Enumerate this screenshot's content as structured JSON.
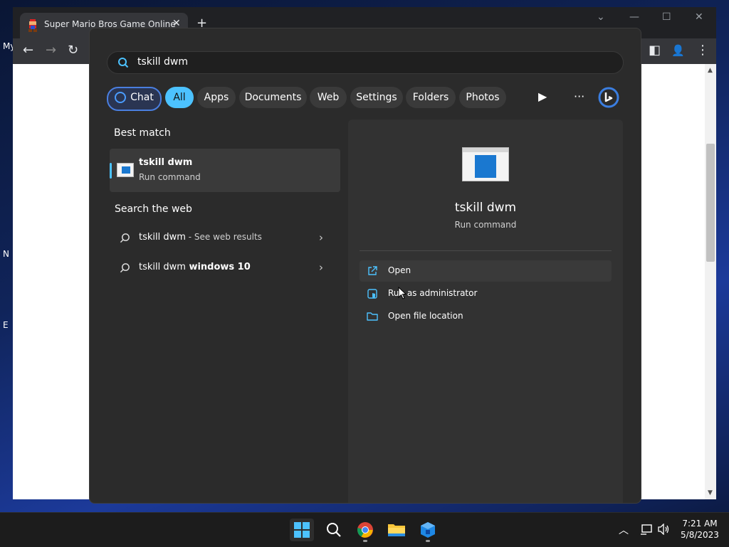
{
  "browser": {
    "tab_title": "Super Mario Bros Game Online",
    "tab_close": "✕",
    "new_tab": "+",
    "window_controls": {
      "dropdown": "⌄",
      "minimize": "—",
      "maximize": "☐",
      "close": "✕"
    },
    "toolbar": {
      "back": "←",
      "forward": "→",
      "reload": "↻",
      "side_panel": "◧",
      "profile": "👤",
      "menu": "⋮"
    }
  },
  "desktop_edge_labels": [
    "My",
    "N",
    "E"
  ],
  "start_menu": {
    "search": {
      "value": "tskill dwm"
    },
    "filters": [
      "Chat",
      "All",
      "Apps",
      "Documents",
      "Web",
      "Settings",
      "Folders",
      "Photos"
    ],
    "active_filter": "All",
    "more_label": "···",
    "best_match": {
      "section_title": "Best match",
      "name": "tskill dwm",
      "subtitle": "Run command"
    },
    "search_the_web": {
      "section_title": "Search the web",
      "items": [
        {
          "query": "tskill dwm",
          "suffix": " - See web results"
        },
        {
          "query": "tskill dwm",
          "suffix": " windows 10"
        }
      ]
    },
    "detail": {
      "name": "tskill dwm",
      "subtitle": "Run command",
      "actions": [
        {
          "label": "Open",
          "icon": "open-external-icon"
        },
        {
          "label": "Run as administrator",
          "icon": "admin-shield-icon"
        },
        {
          "label": "Open file location",
          "icon": "folder-icon"
        }
      ]
    }
  },
  "taskbar": {
    "apps": [
      "start-icon",
      "search-icon",
      "chrome-icon",
      "file-explorer-icon",
      "app-icon"
    ],
    "clock": {
      "time": "7:21 AM",
      "date": "5/8/2023"
    }
  },
  "colors": {
    "accent": "#4cc2ff",
    "menu_bg": "#2b2b2b",
    "panel_bg": "#323232"
  }
}
